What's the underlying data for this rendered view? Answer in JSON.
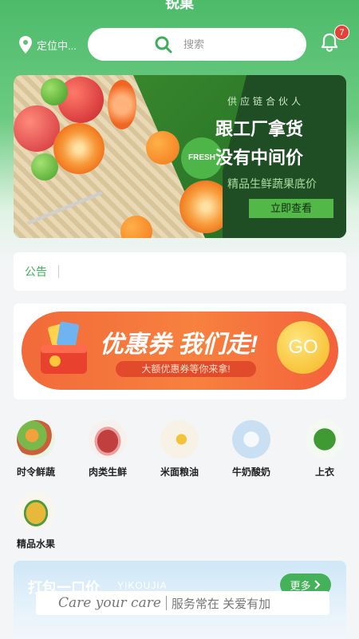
{
  "header": {
    "title": "锐菓",
    "location": "定位中...",
    "search_placeholder": "搜索",
    "notification_count": "7"
  },
  "banner": {
    "subtitle": "供应链合伙人",
    "line1": "跟工厂拿货",
    "line2": "没有中间价",
    "line3": "精品生鲜蔬果底价",
    "button": "立即查看",
    "badge": "FRESH"
  },
  "notice": {
    "label": "公告"
  },
  "coupon": {
    "title": "优惠券 我们走!",
    "subtitle": "大额优惠券等你来拿!",
    "go": "GO"
  },
  "categories": [
    {
      "label": "时令鲜蔬",
      "icon": "vegetables-basket-icon"
    },
    {
      "label": "肉类生鲜",
      "icon": "meat-icon"
    },
    {
      "label": "米面粮油",
      "icon": "grain-oil-icon"
    },
    {
      "label": "牛奶酸奶",
      "icon": "milk-icon"
    },
    {
      "label": "上衣",
      "icon": "leafy-greens-icon"
    },
    {
      "label": "精品水果",
      "icon": "pineapple-icon"
    }
  ],
  "promo": {
    "title": "打包一口价",
    "subtitle": "YIKOUJIA",
    "more": "更多",
    "care_en": "Care your care",
    "care_cn": "服务常在 关爱有加"
  },
  "colors": {
    "brand_green": "#4cbb6a",
    "badge_red": "#e5413b",
    "coupon_orange": "#f7813f"
  }
}
